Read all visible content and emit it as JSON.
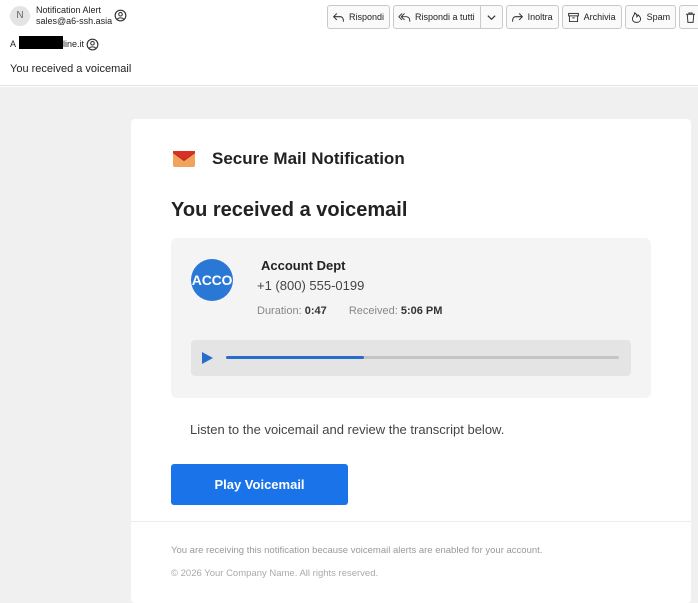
{
  "header": {
    "sender_initial": "N",
    "sender_name": "Notification Alert",
    "sender_email": "sales@a6-ssh.asia",
    "to_label": "A",
    "to_domain_visible": "line.it",
    "subject": "You received a voicemail"
  },
  "toolbar": {
    "reply": "Rispondi",
    "reply_all": "Rispondi a tutti",
    "forward": "Inoltra",
    "archive": "Archivia",
    "spam": "Spam"
  },
  "email": {
    "brand_title": "Secure Mail Notification",
    "headline": "You received a voicemail",
    "caller": {
      "avatar_text": "ACCO",
      "name": "Account Dept",
      "phone": "+1 (800) 555-0199",
      "duration_label": "Duration:",
      "duration": "0:47",
      "received_label": "Received:",
      "received": "5:06 PM"
    },
    "player": {
      "progress": 0.35
    },
    "instructions": "Listen to the voicemail and review the transcript below.",
    "cta_label": "Play Voicemail",
    "footer_notice": "You are receiving this notification because voicemail alerts are enabled for your account.",
    "copyright": "© 2026 Your Company Name. All rights reserved."
  },
  "colors": {
    "accent": "#1a73e8",
    "avatar": "#2a78d6",
    "player_progress": "#2a6ccc",
    "body_background": "#f0f0f0"
  },
  "icons": {
    "sender_contact": "contact-circle-icon",
    "recipient_contact": "contact-circle-icon",
    "reply": "reply-icon",
    "reply_all": "reply-all-icon",
    "dropdown": "chevron-down-icon",
    "forward": "forward-icon",
    "archive": "archive-box-icon",
    "spam": "spam-fire-icon",
    "delete": "trash-icon",
    "brand": "envelope-icon",
    "play": "play-icon"
  }
}
